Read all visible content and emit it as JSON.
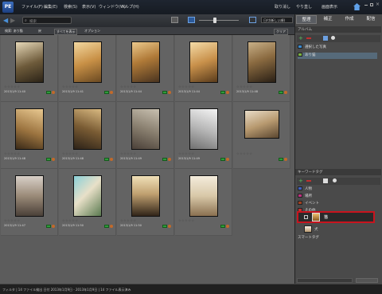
{
  "menubar": {
    "logo": "PE",
    "items": [
      "ファイル(F)",
      "編集(E)",
      "検索(S)",
      "表示(V)",
      "ウィンドウ(W)",
      "ヘルプ(H)"
    ],
    "right": [
      "取り消し",
      "やり直し",
      "画面表示"
    ]
  },
  "toolbar": {
    "search_label": "検索",
    "sort_label": "日付(新しい順)"
  },
  "subbar": {
    "filter_label": "検索: あり猫",
    "back": "戻",
    "group_btn": "すべてを表示",
    "options": "オプション",
    "clear": "クリア"
  },
  "tabs": [
    "整理",
    "補正",
    "作成",
    "配信"
  ],
  "albums": {
    "header": "アルバム",
    "items": [
      "選択した写真",
      "あり猫"
    ]
  },
  "keywords": {
    "header": "キーワードタグ",
    "items": [
      "人物",
      "場所",
      "イベント",
      "その他",
      "猫",
      "犬",
      "スマートタグ"
    ]
  },
  "photos": [
    {
      "date": "2013/1/9 11:40"
    },
    {
      "date": "2013/1/9 11:41"
    },
    {
      "date": "2013/1/9 11:44"
    },
    {
      "date": "2013/1/9 11:44"
    },
    {
      "date": "2013/1/9 11:48"
    },
    {
      "date": "2013/1/9 11:48"
    },
    {
      "date": "2013/1/9 11:48"
    },
    {
      "date": "2013/1/9 11:49"
    },
    {
      "date": "2013/1/9 11:49"
    },
    {
      "date": "2013/1/9 11:47"
    },
    {
      "date": "2013/1/9 11:50"
    },
    {
      "date": "2013/1/9 11:50"
    }
  ],
  "status": "フィルタ | 14 ファイル検出 日付 2013年1月9日 - 2013年1月9日 | 14 ファイル表示済み",
  "colors": {
    "accent": "#c8141e",
    "album_sel": "#566a7a",
    "tag_green": "#2e9b3a"
  }
}
